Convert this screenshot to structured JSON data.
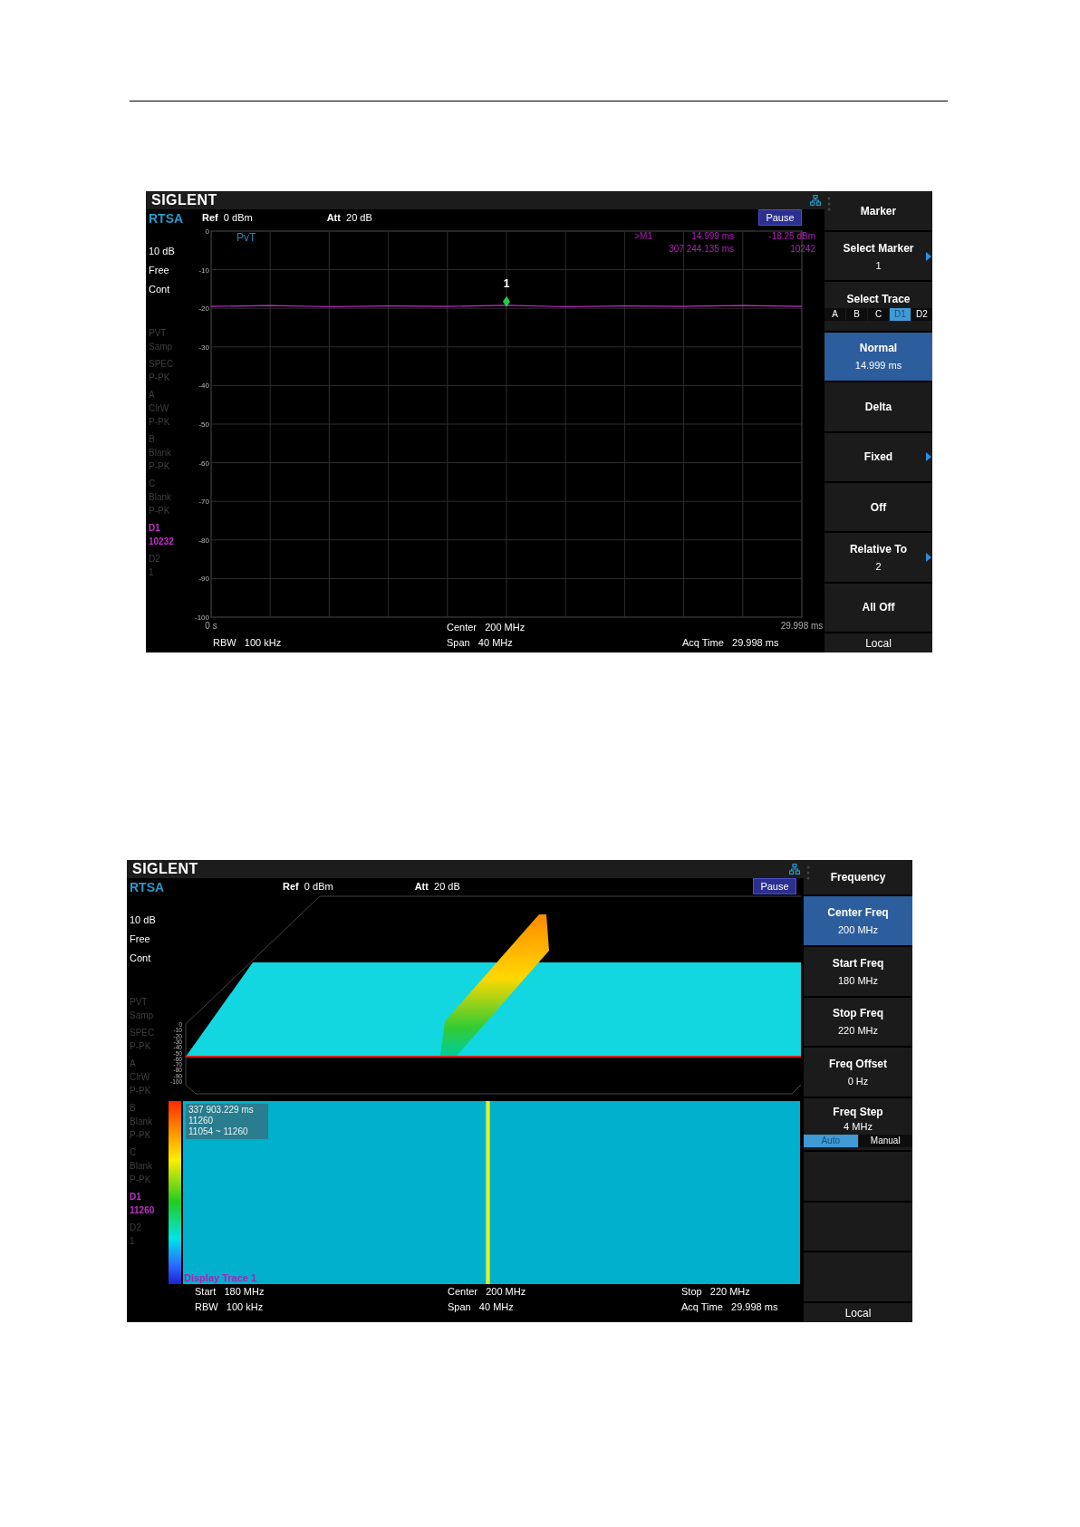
{
  "screens": [
    {
      "kind": "pvt",
      "logo": "SIGLENT",
      "mode": "RTSA",
      "settings": [
        "10 dB",
        "Free",
        "Cont"
      ],
      "traces": [
        {
          "name": "PVT",
          "lines": [
            "Samp"
          ],
          "active": false
        },
        {
          "name": "SPEC",
          "lines": [
            "P-PK"
          ],
          "active": false
        },
        {
          "name": "A",
          "lines": [
            "ClrW",
            "P-PK"
          ],
          "active": false
        },
        {
          "name": "B",
          "lines": [
            "Blank",
            "P-PK"
          ],
          "active": false
        },
        {
          "name": "C",
          "lines": [
            "Blank",
            "P-PK"
          ],
          "active": false
        },
        {
          "name": "D1",
          "lines": [
            "10232"
          ],
          "active": true
        },
        {
          "name": "D2",
          "lines": [
            "1"
          ],
          "active": false
        }
      ],
      "header": {
        "ref": {
          "label": "Ref",
          "value": "0 dBm"
        },
        "att": {
          "label": "Att",
          "value": "20 dB"
        },
        "button": "Pause"
      },
      "plot": {
        "title": "PvT",
        "readout": [
          [
            ">M1",
            "14.999 ms",
            "-18.25 dBm"
          ],
          [
            "307 244.135 ms",
            "10242"
          ]
        ],
        "chart_data": {
          "type": "line",
          "grid": true,
          "x": [
            0,
            3,
            6,
            9,
            12,
            15,
            18,
            21,
            24,
            27,
            29.998
          ],
          "xlim": [
            0,
            29.998
          ],
          "ylim": [
            -100,
            0
          ],
          "yticks": [
            {
              "value": 0,
              "label": "0"
            },
            {
              "value": -10,
              "label": "-10"
            },
            {
              "value": -20,
              "label": "-20"
            },
            {
              "value": -30,
              "label": "-30"
            },
            {
              "value": -40,
              "label": "-40"
            },
            {
              "value": -50,
              "label": "-50"
            },
            {
              "value": -60,
              "label": "-60"
            },
            {
              "value": -70,
              "label": "-70"
            },
            {
              "value": -80,
              "label": "-80"
            },
            {
              "value": -90,
              "label": "-90"
            },
            {
              "value": -100,
              "label": "-100"
            }
          ],
          "xticks": [
            {
              "value": 0,
              "label": "0 s"
            },
            {
              "value": 29.998,
              "label": "29.998 ms"
            }
          ],
          "series": [
            {
              "color": "#c030c8",
              "values": [
                -19.5,
                -19.3,
                -19.6,
                -19.4,
                -19.5,
                -19.2,
                -19.6,
                -19.4,
                -19.5,
                -19.3,
                -19.5
              ]
            }
          ],
          "annotations": [
            {
              "x": 14.999,
              "y": -18.25,
              "text": "1"
            }
          ]
        }
      },
      "footer": [
        {
          "center": {
            "label": "Center",
            "value": "200 MHz"
          }
        },
        {
          "left": {
            "label": "RBW",
            "value": "100 kHz"
          },
          "center": {
            "label": "Span",
            "value": "40 MHz"
          },
          "right": {
            "label": "Acq Time",
            "value": "29.998 ms"
          }
        }
      ],
      "menu": {
        "title": "Marker",
        "footer": "Local",
        "items": [
          {
            "kind": "button",
            "label": "Select Marker",
            "value": "1",
            "arrow": true,
            "selected": false
          },
          {
            "kind": "tabs",
            "label": "Select Trace",
            "options": [
              {
                "label": "A",
                "selected": false
              },
              {
                "label": "B",
                "selected": false
              },
              {
                "label": "C",
                "selected": false
              },
              {
                "label": "D1",
                "selected": true
              },
              {
                "label": "D2",
                "selected": false
              }
            ]
          },
          {
            "kind": "button",
            "label": "Normal",
            "value": "14.999 ms",
            "arrow": false,
            "selected": true
          },
          {
            "kind": "button",
            "label": "Delta",
            "arrow": false,
            "selected": false
          },
          {
            "kind": "button",
            "label": "Fixed",
            "arrow": true,
            "selected": false
          },
          {
            "kind": "button",
            "label": "Off",
            "arrow": false,
            "selected": false
          },
          {
            "kind": "button",
            "label": "Relative To",
            "value": "2",
            "arrow": true,
            "selected": false
          },
          {
            "kind": "button",
            "label": "All Off",
            "arrow": false,
            "selected": false
          }
        ]
      }
    },
    {
      "kind": "waterfall",
      "logo": "SIGLENT",
      "mode": "RTSA",
      "settings": [
        "10 dB",
        "Free",
        "Cont"
      ],
      "traces": [
        {
          "name": "PVT",
          "lines": [
            "Samp"
          ],
          "active": false
        },
        {
          "name": "SPEC",
          "lines": [
            "P-PK"
          ],
          "active": false
        },
        {
          "name": "A",
          "lines": [
            "ClrW",
            "P-PK"
          ],
          "active": false
        },
        {
          "name": "B",
          "lines": [
            "Blank",
            "P-PK"
          ],
          "active": false
        },
        {
          "name": "C",
          "lines": [
            "Blank",
            "P-PK"
          ],
          "active": false
        },
        {
          "name": "D1",
          "lines": [
            "11260"
          ],
          "active": true
        },
        {
          "name": "D2",
          "lines": [
            "1"
          ],
          "active": false
        }
      ],
      "header": {
        "ref": {
          "label": "Ref",
          "value": "0 dBm"
        },
        "att": {
          "label": "Att",
          "value": "20 dB"
        },
        "button": "Pause"
      },
      "view3d": {
        "axis_labels": [
          "0",
          "-10",
          "-20",
          "-30",
          "-40",
          "-50",
          "-60",
          "-70",
          "-80",
          "-90",
          "-100"
        ]
      },
      "spectrogram": {
        "info": [
          "337 903.229 ms",
          "11260",
          "11054 ~ 11260"
        ],
        "label": "Display Trace 1"
      },
      "footer": [
        {
          "left": {
            "label": "Start",
            "value": "180 MHz"
          },
          "center": {
            "label": "Center",
            "value": "200 MHz"
          },
          "right": {
            "label": "Stop",
            "value": "220 MHz"
          }
        },
        {
          "left": {
            "label": "RBW",
            "value": "100 kHz"
          },
          "center": {
            "label": "Span",
            "value": "40 MHz"
          },
          "right": {
            "label": "Acq Time",
            "value": "29.998 ms"
          }
        }
      ],
      "menu": {
        "title": "Frequency",
        "footer": "Local",
        "items": [
          {
            "kind": "button",
            "label": "Center Freq",
            "value": "200 MHz",
            "arrow": false,
            "selected": true
          },
          {
            "kind": "button",
            "label": "Start Freq",
            "value": "180 MHz",
            "arrow": false,
            "selected": false
          },
          {
            "kind": "button",
            "label": "Stop Freq",
            "value": "220 MHz",
            "arrow": false,
            "selected": false
          },
          {
            "kind": "button",
            "label": "Freq Offset",
            "value": "0 Hz",
            "arrow": false,
            "selected": false
          },
          {
            "kind": "tabs",
            "label": "Freq Step",
            "value": "4 MHz",
            "options": [
              {
                "label": "Auto",
                "selected": true
              },
              {
                "label": "Manual",
                "selected": false
              }
            ]
          },
          {
            "kind": "blank"
          },
          {
            "kind": "blank"
          },
          {
            "kind": "blank"
          }
        ]
      }
    }
  ]
}
